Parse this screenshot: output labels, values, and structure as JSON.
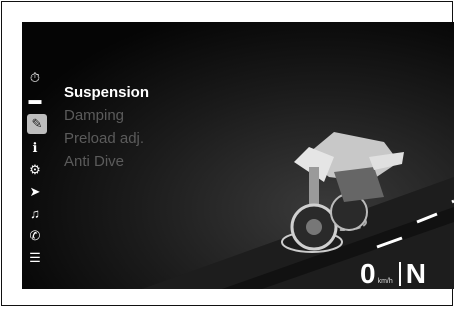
{
  "menu": {
    "title": "Suspension",
    "items": [
      "Damping",
      "Preload adj.",
      "Anti Dive"
    ]
  },
  "sidebar": {
    "icons": [
      {
        "name": "stopwatch-icon",
        "glyph": "⏱"
      },
      {
        "name": "motorcycle-icon",
        "glyph": "🏍"
      },
      {
        "name": "wrench-icon",
        "glyph": "✎",
        "active": true
      },
      {
        "name": "info-icon",
        "glyph": "ℹ"
      },
      {
        "name": "bike-settings-icon",
        "glyph": "⚙"
      },
      {
        "name": "navigation-arrow-icon",
        "glyph": "➤"
      },
      {
        "name": "music-note-icon",
        "glyph": "♫"
      },
      {
        "name": "phone-icon",
        "glyph": "✆"
      },
      {
        "name": "sliders-icon",
        "glyph": "☰"
      }
    ]
  },
  "status": {
    "speed": "0",
    "unit": "km/h",
    "gear": "N"
  },
  "colors": {
    "menu_active": "#ffffff",
    "menu_inactive": "#5b5b5b",
    "icon_active_bg": "#bdbdbd"
  }
}
